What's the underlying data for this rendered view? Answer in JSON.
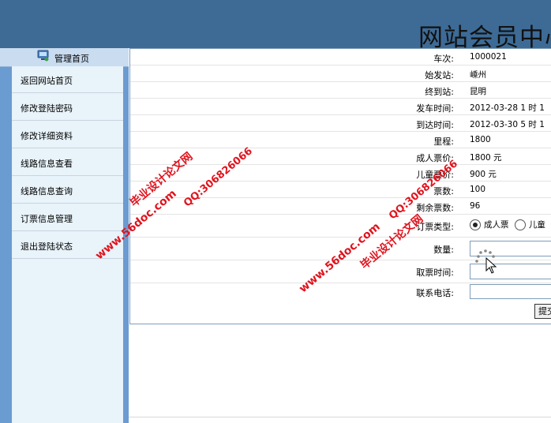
{
  "header": {
    "title": "网站会员中心"
  },
  "sidebar": {
    "head_label": "管理首页",
    "items": [
      {
        "label": "返回网站首页"
      },
      {
        "label": "修改登陆密码"
      },
      {
        "label": "修改详细资料"
      },
      {
        "label": "线路信息查看"
      },
      {
        "label": "线路信息查询"
      },
      {
        "label": "订票信息管理"
      },
      {
        "label": "退出登陆状态"
      }
    ]
  },
  "form": {
    "fields": [
      {
        "label": "车次:",
        "value": "1000021"
      },
      {
        "label": "始发站:",
        "value": "嵊州"
      },
      {
        "label": "终到站:",
        "value": "昆明"
      },
      {
        "label": "发车时间:",
        "value": "2012-03-28 1 时 1"
      },
      {
        "label": "到达时间:",
        "value": "2012-03-30 5 时 1"
      },
      {
        "label": "里程:",
        "value": "1800"
      },
      {
        "label": "成人票价:",
        "value": "1800 元"
      },
      {
        "label": "儿童票价:",
        "value": "900 元"
      },
      {
        "label": "票数:",
        "value": "100"
      },
      {
        "label": "剩余票数:",
        "value": "96"
      }
    ],
    "ticket_type_label": "订票类型:",
    "ticket_type_options": [
      "成人票",
      "儿童"
    ],
    "quantity_label": "数量:",
    "pickup_time_label": "取票时间:",
    "phone_label": "联系电话:",
    "submit_label": "提交"
  },
  "watermarks": {
    "site": "www.56doc.com",
    "qq": "QQ:306826066",
    "name": "毕业设计论文网"
  },
  "colors": {
    "header_bg": "#3d6b96",
    "sidebar_bg": "#6a9bd1",
    "menu_bg": "#e8f3fa",
    "watermark": "#e0141e"
  }
}
